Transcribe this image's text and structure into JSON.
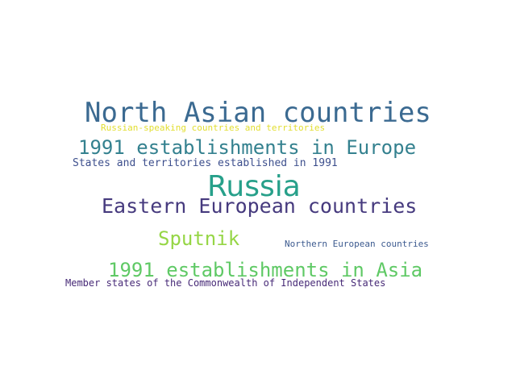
{
  "words": [
    {
      "text": "North Asian countries",
      "color": "#3b6a91"
    },
    {
      "text": "Russian-speaking countries and territories",
      "color": "#e2de2f"
    },
    {
      "text": "1991 establishments in Europe",
      "color": "#34818f"
    },
    {
      "text": "States and territories established in 1991",
      "color": "#3d4f8d"
    },
    {
      "text": "Russia",
      "color": "#27a08a"
    },
    {
      "text": "Eastern European countries",
      "color": "#463a7e"
    },
    {
      "text": "Sputnik",
      "color": "#96d646"
    },
    {
      "text": "Northern European countries",
      "color": "#3c5a8f"
    },
    {
      "text": "1991 establishments in Asia",
      "color": "#5fc965"
    },
    {
      "text": "Member states of the Commonwealth of Independent States",
      "color": "#472a77"
    }
  ]
}
